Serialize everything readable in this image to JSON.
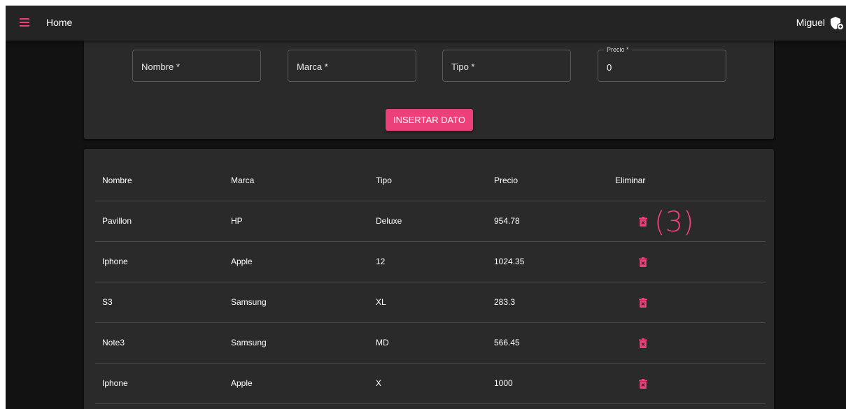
{
  "appbar": {
    "title": "Home",
    "user": "Miguel",
    "icons": {
      "menu": "menu-icon",
      "user": "user-shield-icon"
    }
  },
  "form": {
    "fields": [
      {
        "label": "Nombre *",
        "value": ""
      },
      {
        "label": "Marca *",
        "value": ""
      },
      {
        "label": "Tipo *",
        "value": ""
      },
      {
        "label": "Precio *",
        "value": "0"
      }
    ],
    "submit_label": "INSERTAR DATO"
  },
  "table": {
    "headers": [
      "Nombre",
      "Marca",
      "Tipo",
      "Precio",
      "Eliminar"
    ],
    "rows": [
      {
        "nombre": "Pavillon",
        "marca": "HP",
        "tipo": "Deluxe",
        "precio": "954.78"
      },
      {
        "nombre": "Iphone",
        "marca": "Apple",
        "tipo": "12",
        "precio": "1024.35"
      },
      {
        "nombre": "S3",
        "marca": "Samsung",
        "tipo": "XL",
        "precio": "283.3"
      },
      {
        "nombre": "Note3",
        "marca": "Samsung",
        "tipo": "MD",
        "precio": "566.45"
      },
      {
        "nombre": "Iphone",
        "marca": "Apple",
        "tipo": "X",
        "precio": "1000"
      }
    ],
    "delete_icon": "trash-icon"
  },
  "annotation": "(3)",
  "colors": {
    "accent": "#ec407a",
    "appbar": "#242424",
    "card": "#2a2a2a",
    "background": "#121212"
  }
}
